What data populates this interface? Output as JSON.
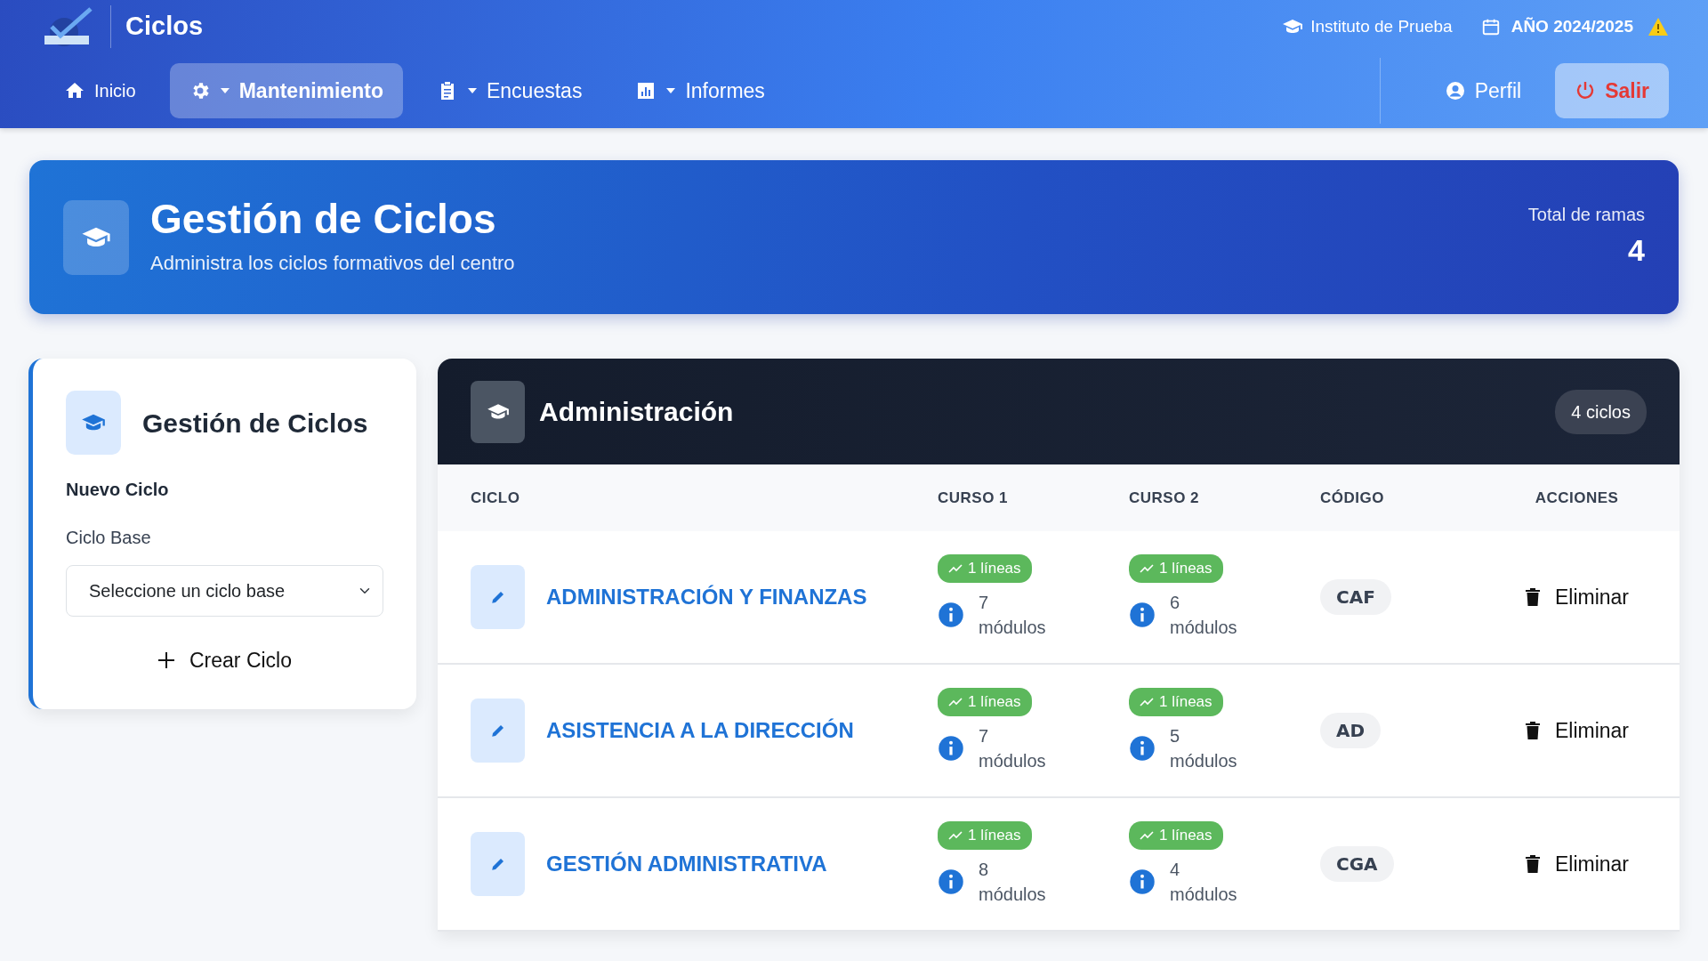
{
  "app": {
    "title": "Ciclos",
    "institute": "Instituto de Prueba",
    "year": "AÑO 2024/2025",
    "year_warning": true
  },
  "nav": [
    {
      "label": "Inicio",
      "kind": "home",
      "dropdown": false,
      "selected": false
    },
    {
      "label": "Mantenimiento",
      "kind": "settings",
      "dropdown": true,
      "selected": true
    },
    {
      "label": "Encuestas",
      "kind": "surveys",
      "dropdown": true,
      "selected": false
    },
    {
      "label": "Informes",
      "kind": "reports",
      "dropdown": true,
      "selected": false
    }
  ],
  "user_nav": [
    {
      "label": "Perfil",
      "kind": "profile"
    },
    {
      "label": "Salir",
      "kind": "logout"
    }
  ],
  "header": {
    "title": "Gestión de Ciclos",
    "subtitle": "Administra los ciclos formativos del centro",
    "total_label": "Total de ramas",
    "total": "4"
  },
  "form": {
    "title": "Gestión de Ciclos",
    "section": "Nuevo Ciclo",
    "field_label": "Ciclo Base",
    "select_value": "Seleccione un ciclo base",
    "submit": "Crear Ciclo"
  },
  "branch": {
    "name": "Administración",
    "count": "4 ciclos",
    "columns": [
      "CICLO",
      "CURSO 1",
      "CURSO 2",
      "CÓDIGO",
      "ACCIONES"
    ],
    "rows": [
      {
        "name": "ADMINISTRACIÓN Y FINANZAS",
        "curso1": {
          "lines": "1 líneas",
          "modules": "7 módulos"
        },
        "curso2": {
          "lines": "1 líneas",
          "modules": "6 módulos"
        },
        "code": "CAF",
        "action": "Eliminar"
      },
      {
        "name": "ASISTENCIA A LA DIRECCIÓN",
        "curso1": {
          "lines": "1 líneas",
          "modules": "7 módulos"
        },
        "curso2": {
          "lines": "1 líneas",
          "modules": "5 módulos"
        },
        "code": "AD",
        "action": "Eliminar"
      },
      {
        "name": "GESTIÓN ADMINISTRATIVA",
        "curso1": {
          "lines": "1 líneas",
          "modules": "8 módulos"
        },
        "curso2": {
          "lines": "1 líneas",
          "modules": "4 módulos"
        },
        "code": "CGA",
        "action": "Eliminar"
      }
    ]
  }
}
